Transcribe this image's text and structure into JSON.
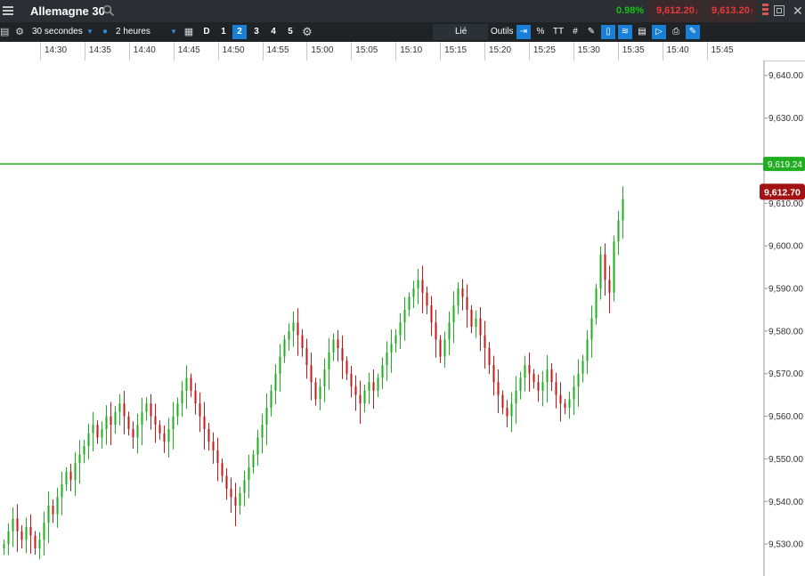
{
  "titlebar": {
    "menu_icon": "hamburger-menu-icon",
    "instrument": "Allemagne 30",
    "search_icon": "search-icon",
    "change_pct": "0.98%",
    "sell_price": "9,612.20",
    "buy_price": "9,613.20",
    "change_color": "#17c317",
    "price_color": "#e83a3a",
    "restore_icon": "restore-window-icon",
    "close_icon": "close-icon"
  },
  "toolbar": {
    "interval": "30 secondes",
    "range": "2 heures",
    "period_d": "D",
    "periods": [
      "1",
      "2",
      "3",
      "4",
      "5"
    ],
    "active_period": "2",
    "linked_label": "Lié",
    "tools_label": "Outils",
    "percent_label": "%",
    "text_tool_label": "TT",
    "accent": "#1a7fd6"
  },
  "chart_data": {
    "type": "candlestick",
    "instrument": "Allemagne 30",
    "x_ticks": [
      "14:30",
      "14:35",
      "14:40",
      "14:45",
      "14:50",
      "14:55",
      "15:00",
      "15:05",
      "15:10",
      "15:15",
      "15:20",
      "15:25",
      "15:30",
      "15:35",
      "15:40",
      "15:45"
    ],
    "y_ticks": [
      "9,530.00",
      "9,540.00",
      "9,550.00",
      "9,560.00",
      "9,570.00",
      "9,580.00",
      "9,590.00",
      "9,600.00",
      "9,610.00",
      "9,620.00",
      "9,630.00",
      "9,640.00"
    ],
    "ylim": [
      9522.5,
      9643.5
    ],
    "up_color": "#1fae1f",
    "down_color": "#c11a1a",
    "reference_line": {
      "value": 9619.24,
      "label": "9,619.24",
      "color": "#1fae1f"
    },
    "last_price": {
      "value": 9612.7,
      "label": "9,612.70",
      "color": "#a31212"
    },
    "start_time": "14:25:30",
    "bar_interval_seconds": 30,
    "close_series": [
      9530,
      9533,
      9536,
      9533,
      9531,
      9534,
      9532,
      9529,
      9531,
      9535,
      9539,
      9537,
      9541,
      9544,
      9547,
      9545,
      9549,
      9551,
      9553,
      9556,
      9558,
      9555,
      9557,
      9560,
      9558,
      9561,
      9563,
      9560,
      9557,
      9555,
      9558,
      9561,
      9563,
      9560,
      9558,
      9556,
      9554,
      9557,
      9560,
      9563,
      9566,
      9569,
      9566,
      9563,
      9560,
      9557,
      9554,
      9552,
      9549,
      9546,
      9543,
      9541,
      9539,
      9542,
      9545,
      9548,
      9551,
      9555,
      9558,
      9562,
      9566,
      9570,
      9574,
      9578,
      9580,
      9582,
      9579,
      9576,
      9572,
      9568,
      9564,
      9567,
      9571,
      9575,
      9578,
      9576,
      9573,
      9570,
      9567,
      9565,
      9563,
      9566,
      9568,
      9566,
      9569,
      9572,
      9575,
      9577,
      9579,
      9582,
      9585,
      9588,
      9590,
      9592,
      9589,
      9586,
      9582,
      9578,
      9574,
      9578,
      9582,
      9586,
      9590,
      9588,
      9585,
      9581,
      9583,
      9579,
      9576,
      9572,
      9568,
      9565,
      9562,
      9560,
      9563,
      9566,
      9569,
      9572,
      9570,
      9568,
      9566,
      9568,
      9571,
      9568,
      9565,
      9563,
      9562,
      9564,
      9567,
      9570,
      9573,
      9578,
      9583,
      9590,
      9598,
      9592,
      9589,
      9601,
      9606,
      9611
    ]
  }
}
